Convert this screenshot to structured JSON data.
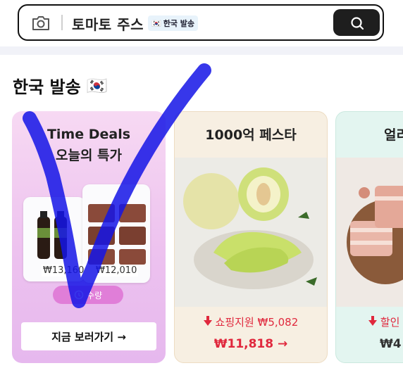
{
  "search": {
    "query": "토마토 주스",
    "chip_label": "한국 발송",
    "chip_flag": "🇰🇷"
  },
  "section": {
    "title": "한국 발송",
    "flag": "🇰🇷"
  },
  "cards": [
    {
      "title_line1": "Time Deals",
      "title_line2": "오늘의 특가",
      "price_1": "₩13,160",
      "price_2": "₩12,010",
      "badge": "수량",
      "button": "지금 보러가기 →"
    },
    {
      "title": "1000억 페스타",
      "subsidy": "쇼핑지원 ₩5,082",
      "price": "₩11,818 →"
    },
    {
      "title": "얼리",
      "subsidy": "할인",
      "price": "₩4"
    }
  ],
  "colors": {
    "accent_red": "#e0283d",
    "timedeal_pink": "#edc2ef",
    "search_button": "#1e1e1e",
    "annotation_blue": "#1414e6"
  },
  "icons": [
    "camera-icon",
    "search-icon",
    "korea-flag-icon",
    "clock-icon",
    "red-arrow-icon"
  ]
}
